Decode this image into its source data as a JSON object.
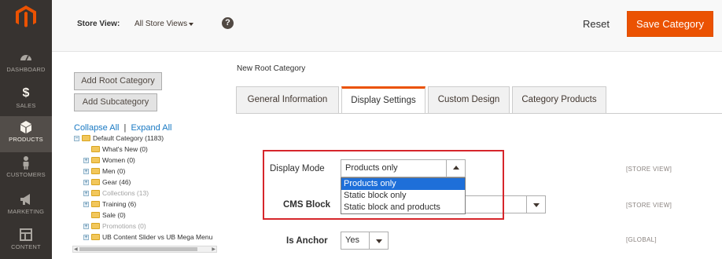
{
  "nav": {
    "items": [
      {
        "label": "DASHBOARD",
        "icon": "dashboard-icon"
      },
      {
        "label": "SALES",
        "icon": "dollar-icon"
      },
      {
        "label": "PRODUCTS",
        "icon": "cube-icon"
      },
      {
        "label": "CUSTOMERS",
        "icon": "person-icon"
      },
      {
        "label": "MARKETING",
        "icon": "megaphone-icon"
      },
      {
        "label": "CONTENT",
        "icon": "layout-icon"
      }
    ]
  },
  "header": {
    "store_view_label": "Store View:",
    "store_view_value": "All Store Views",
    "help": "?",
    "reset_label": "Reset",
    "save_label": "Save Category"
  },
  "left": {
    "add_root": "Add Root Category",
    "add_sub": "Add Subcategory",
    "collapse_all": "Collapse All",
    "separator": "|",
    "expand_all": "Expand All",
    "tree": [
      {
        "label": "Default Category (1183)"
      },
      {
        "label": "What's New (0)"
      },
      {
        "label": "Women (0)"
      },
      {
        "label": "Men (0)"
      },
      {
        "label": "Gear (46)"
      },
      {
        "label": "Collections (13)"
      },
      {
        "label": "Training (6)"
      },
      {
        "label": "Sale (0)"
      },
      {
        "label": "Promotions (0)"
      },
      {
        "label": "UB Content Slider vs UB Mega Menu"
      }
    ]
  },
  "main": {
    "page_title": "New Root Category",
    "tabs": [
      {
        "label": "General Information"
      },
      {
        "label": "Display Settings"
      },
      {
        "label": "Custom Design"
      },
      {
        "label": "Category Products"
      }
    ],
    "fields": {
      "display_mode": {
        "label": "Display Mode",
        "value": "Products only",
        "scope": "[STORE VIEW]"
      },
      "cms_block": {
        "label": "CMS Block",
        "value": "",
        "scope": "[STORE VIEW]"
      },
      "is_anchor": {
        "label": "Is Anchor",
        "value": "Yes",
        "scope": "[GLOBAL]"
      }
    },
    "display_mode_options": [
      "Products only",
      "Static block only",
      "Static block and products"
    ]
  },
  "colors": {
    "accent": "#eb5202",
    "nav_bg": "#373330",
    "highlight": "#d6262b",
    "option_selected": "#1e6fd9"
  }
}
